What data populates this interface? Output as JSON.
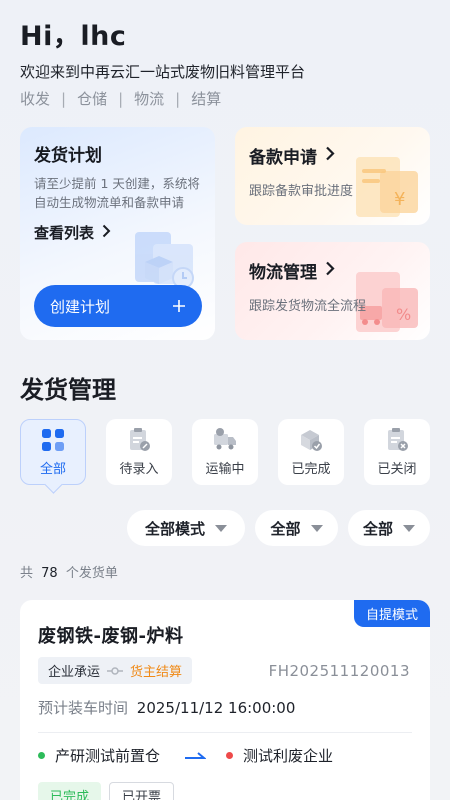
{
  "header": {
    "greeting": "Hi，lhc",
    "welcome": "欢迎来到中再云汇一站式废物旧料管理平台",
    "tags": [
      "收发",
      "仓储",
      "物流",
      "结算"
    ],
    "separator": "|"
  },
  "plan_card": {
    "title": "发货计划",
    "description": "请至少提前 1 天创建，系统将自动生成物流单和备款申请",
    "view_list_label": "查看列表",
    "create_label": "创建计划",
    "create_icon": "plus-icon"
  },
  "fund_card": {
    "title": "备款申请",
    "subtitle": "跟踪备款审批进度"
  },
  "logistics_card": {
    "title": "物流管理",
    "subtitle": "跟踪发货物流全流程"
  },
  "section": {
    "title": "发货管理"
  },
  "tabs": [
    {
      "label": "全部",
      "icon": "grid-icon",
      "active": true
    },
    {
      "label": "待录入",
      "icon": "clipboard-edit-icon",
      "active": false
    },
    {
      "label": "运输中",
      "icon": "truck-icon",
      "active": false
    },
    {
      "label": "已完成",
      "icon": "box-check-icon",
      "active": false
    },
    {
      "label": "已关闭",
      "icon": "clipboard-close-icon",
      "active": false
    }
  ],
  "filters": [
    {
      "label": "全部模式"
    },
    {
      "label": "全部"
    },
    {
      "label": "全部"
    }
  ],
  "count": {
    "prefix": "共",
    "value": "78",
    "suffix": "个发货单"
  },
  "order": {
    "mode": "自提模式",
    "title": "废钢铁-废钢-炉料",
    "carrier": "企业承运",
    "settlement": "货主结算",
    "number": "FH202511120013",
    "load_time_label": "预计装车时间",
    "load_time_value": "2025/11/12 16:00:00",
    "origin": "产研测试前置仓",
    "destination": "测试利废企业",
    "statuses": [
      "已完成",
      "已开票"
    ]
  },
  "colors": {
    "primary": "#1f6bf0",
    "warning": "#f08a17",
    "success": "#2dbb5a",
    "danger": "#ee4a4a"
  }
}
